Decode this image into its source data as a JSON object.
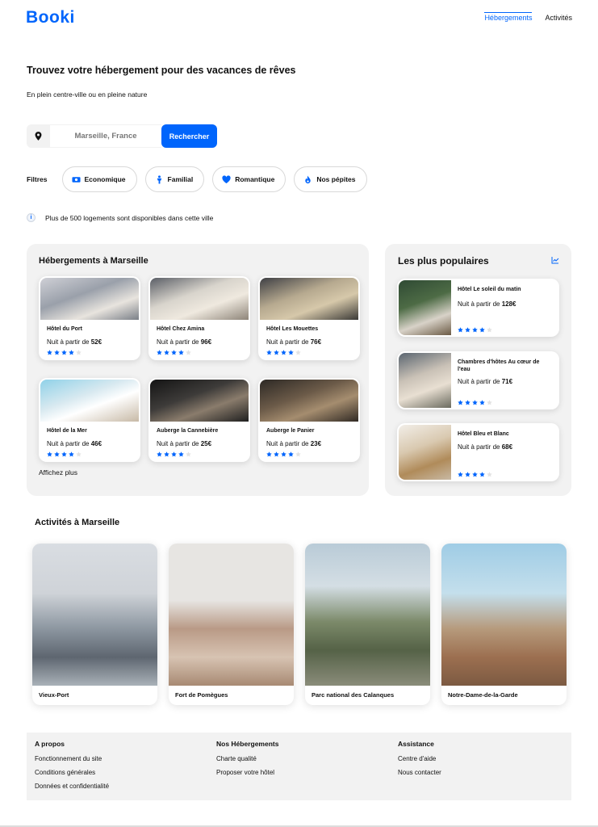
{
  "brand": {
    "logo": "Booki",
    "accent": "#0065FC"
  },
  "nav": {
    "items": [
      "Hébergements",
      "Activités"
    ],
    "active": "Hébergements"
  },
  "hero": {
    "title": "Trouvez votre hébergement pour des vacances de rêves",
    "subtitle": "En plein centre-ville ou en pleine nature"
  },
  "search": {
    "value": "Marseille, France",
    "button": "Rechercher",
    "icon": "map-pin-icon"
  },
  "filters": {
    "label": "Filtres",
    "items": [
      {
        "label": "Economique",
        "icon": "money-icon"
      },
      {
        "label": "Familial",
        "icon": "child-icon"
      },
      {
        "label": "Romantique",
        "icon": "heart-icon"
      },
      {
        "label": "Nos pépites",
        "icon": "fire-icon"
      }
    ]
  },
  "info": {
    "text": "Plus de 500 logements sont disponibles dans cette ville",
    "icon": "info-icon"
  },
  "hebergements": {
    "title": "Hébergements à Marseille",
    "more": "Affichez plus",
    "cards": [
      {
        "name": "Hôtel du Port",
        "price_prefix": "Nuit à partir de ",
        "price": "52€",
        "rating": 4
      },
      {
        "name": "Hôtel Chez Amina",
        "price_prefix": "Nuit à partir de ",
        "price": "96€",
        "rating": 4
      },
      {
        "name": "Hôtel Les Mouettes",
        "price_prefix": "Nuit à partir de ",
        "price": "76€",
        "rating": 4
      },
      {
        "name": "Hôtel de la Mer",
        "price_prefix": "Nuit à partir de ",
        "price": "46€",
        "rating": 4
      },
      {
        "name": "Auberge la Cannebière",
        "price_prefix": "Nuit à partir de ",
        "price": "25€",
        "rating": 4
      },
      {
        "name": "Auberge le Panier",
        "price_prefix": "Nuit à partir de ",
        "price": "23€",
        "rating": 4
      }
    ]
  },
  "populaires": {
    "title": "Les plus populaires",
    "icon": "trending-icon",
    "cards": [
      {
        "name": "Hôtel Le soleil du matin",
        "price_prefix": "Nuit à partir de ",
        "price": "128€",
        "rating": 4
      },
      {
        "name": "Chambres d'hôtes Au cœur de l'eau",
        "price_prefix": "Nuit à partir de ",
        "price": "71€",
        "rating": 4
      },
      {
        "name": "Hôtel Bleu et Blanc",
        "price_prefix": "Nuit à partir de ",
        "price": "68€",
        "rating": 4
      }
    ]
  },
  "activites": {
    "title": "Activités à Marseille",
    "cards": [
      "Vieux-Port",
      "Fort de Pomègues",
      "Parc national des Calanques",
      "Notre-Dame-de-la-Garde"
    ]
  },
  "footer": {
    "columns": [
      {
        "title": "A propos",
        "links": [
          "Fonctionnement du site",
          "Conditions générales",
          "Données et confidentialité"
        ]
      },
      {
        "title": "Nos Hébergements",
        "links": [
          "Charte qualité",
          "Proposer votre hôtel"
        ]
      },
      {
        "title": "Assistance",
        "links": [
          "Centre d'aide",
          "Nous contacter"
        ]
      }
    ]
  }
}
